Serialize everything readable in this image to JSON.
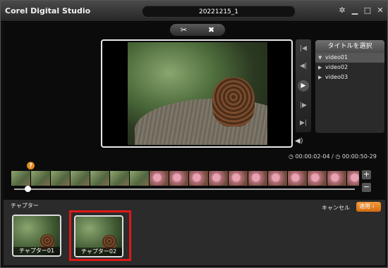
{
  "app": {
    "title": "Corel Digital Studio",
    "project_name": "20221215_1"
  },
  "window_controls": {
    "settings": "✲",
    "minimize": "▁",
    "maximize": "□",
    "close": "✕"
  },
  "view_toggle": {
    "left_icon": "✂",
    "right_icon": "✖"
  },
  "titles_panel": {
    "header": "タイトルを選択",
    "items": [
      {
        "label": "video01",
        "arrow": "▼"
      },
      {
        "label": "video02",
        "arrow": "▶"
      },
      {
        "label": "video03",
        "arrow": "▶"
      }
    ]
  },
  "playback": {
    "prev": "|◀",
    "rewind": "◀|",
    "play": "▶",
    "forward": "|▶",
    "next": "▶|"
  },
  "time": {
    "current": "00:00:02-04",
    "separator": "/",
    "total": "00:00:50-29"
  },
  "timeline": {
    "chapter_marker": "?",
    "zoom_in": "+",
    "zoom_out": "−",
    "playhead_position": 0.04,
    "frames": [
      "g",
      "g",
      "g",
      "g",
      "g",
      "g",
      "g",
      "p",
      "p",
      "p",
      "p",
      "p",
      "p",
      "p",
      "p",
      "p",
      "p",
      "p",
      "p"
    ]
  },
  "chapters": {
    "label": "チャプター",
    "cancel": "キャンセル",
    "apply": "適用",
    "items": [
      {
        "caption": "チャプター01"
      },
      {
        "caption": "チャプター02",
        "selected": true
      }
    ]
  },
  "colors": {
    "accent": "#e08a1e",
    "selection": "#e01818",
    "apply_button": "#f39b3b"
  }
}
